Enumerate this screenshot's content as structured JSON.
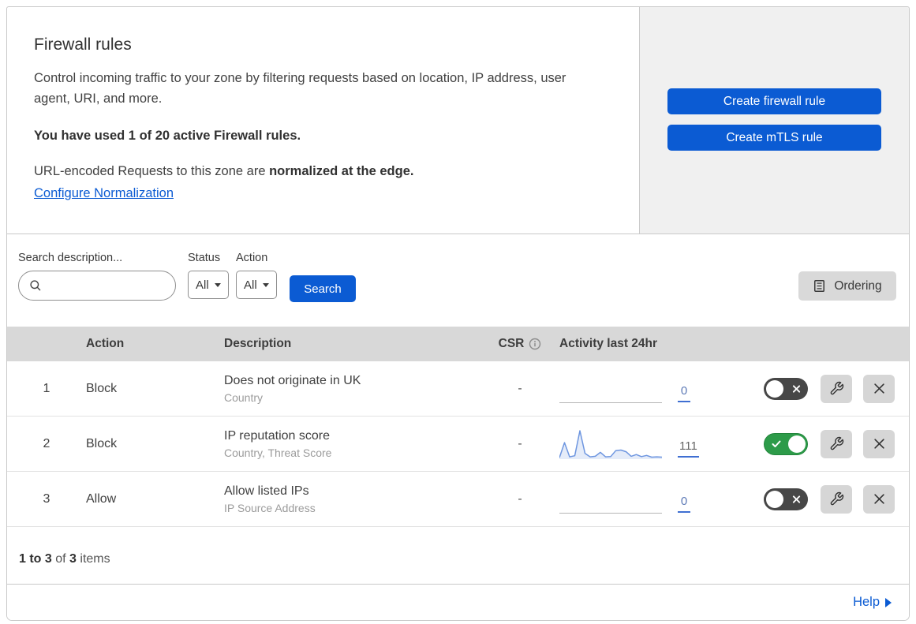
{
  "header": {
    "title": "Firewall rules",
    "description": "Control incoming traffic to your zone by filtering requests based on location, IP address, user agent, URI, and more.",
    "usage": "You have used 1 of 20 active Firewall rules.",
    "normalization_text": "URL-encoded Requests to this zone are ",
    "normalization_bold": "normalized at the edge.",
    "normalization_link": "Configure Normalization",
    "create_firewall_label": "Create firewall rule",
    "create_mtls_label": "Create mTLS rule"
  },
  "filters": {
    "search_label": "Search description...",
    "search_placeholder": "",
    "status_label": "Status",
    "status_value": "All",
    "action_label": "Action",
    "action_value": "All",
    "search_button_label": "Search",
    "ordering_label": "Ordering"
  },
  "table": {
    "columns": {
      "action": "Action",
      "description": "Description",
      "csr": "CSR",
      "activity": "Activity last 24hr"
    },
    "rows": [
      {
        "num": "1",
        "action": "Block",
        "description": "Does not originate in UK",
        "fields": "Country",
        "csr": "-",
        "count": "0",
        "enabled": false,
        "sparkline": "flat"
      },
      {
        "num": "2",
        "action": "Block",
        "description": "IP reputation score",
        "fields": "Country, Threat Score",
        "csr": "-",
        "count": "111",
        "enabled": true,
        "sparkline": "active",
        "sparkline_values": [
          5,
          58,
          8,
          12,
          100,
          20,
          8,
          10,
          24,
          8,
          9,
          30,
          32,
          26,
          10,
          16,
          9,
          13,
          7,
          8,
          7
        ]
      },
      {
        "num": "3",
        "action": "Allow",
        "description": "Allow listed IPs",
        "fields": "IP Source Address",
        "csr": "-",
        "count": "0",
        "enabled": false,
        "sparkline": "flat"
      }
    ]
  },
  "footer": {
    "range": "1 to 3",
    "of_label": "of",
    "total": "3",
    "items_label": "items"
  },
  "help": {
    "label": "Help"
  },
  "icons": {
    "search": "search-icon",
    "info": "info-icon",
    "ordering": "ordering-list-icon",
    "wrench": "wrench-icon",
    "close": "close-icon",
    "check": "check-icon"
  },
  "colors": {
    "accent_blue": "#0b5bd3",
    "toggle_on_green": "#2d9b49",
    "toggle_off_gray": "#474747",
    "panel_gray": "#f0f0f0",
    "table_header_gray": "#d8d8d8",
    "icon_button_gray": "#d6d6d6",
    "sparkline_blue": "#6e96e0",
    "count_underline_blue": "#3f6fd2"
  }
}
